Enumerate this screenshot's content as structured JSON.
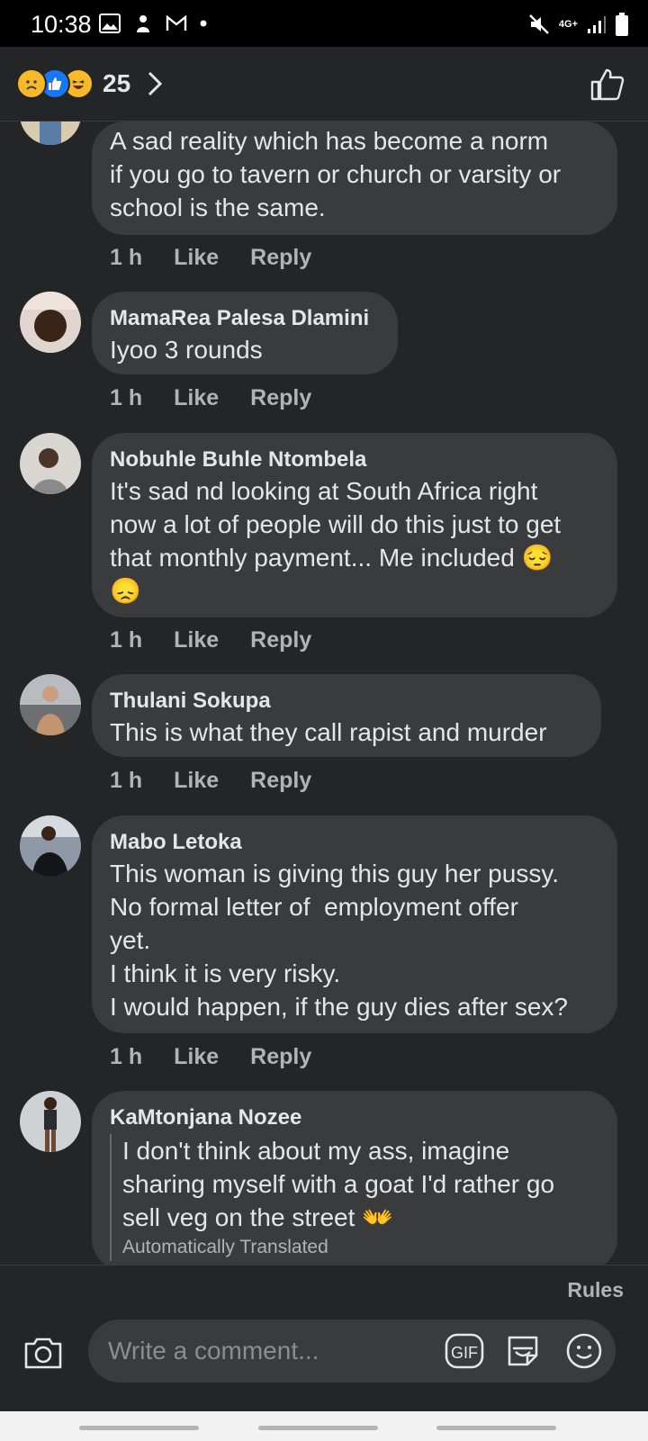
{
  "status_bar": {
    "time": "10:38",
    "network": "4G+"
  },
  "header": {
    "reaction_count": "25",
    "reactions": [
      "sad",
      "like",
      "haha"
    ]
  },
  "comments": [
    {
      "author": "",
      "text": "A sad reality which has become a norm\nif you go to tavern or church or varsity or\nschool is the same.",
      "time": "1 h",
      "like": "Like",
      "reply": "Reply"
    },
    {
      "author": "MamaRea Palesa Dlamini",
      "text": "Iyoo 3 rounds",
      "time": "1 h",
      "like": "Like",
      "reply": "Reply"
    },
    {
      "author": "Nobuhle Buhle Ntombela",
      "text": "It's sad nd looking at South Africa right\nnow a lot of people will do this just to get\nthat monthly payment... Me included 😔\n😞",
      "time": "1 h",
      "like": "Like",
      "reply": "Reply"
    },
    {
      "author": "Thulani Sokupa",
      "text": "This is what they call rapist and murder",
      "time": "1 h",
      "like": "Like",
      "reply": "Reply"
    },
    {
      "author": "Mabo Letoka",
      "text": "This woman is giving this guy her pussy.\nNo formal letter of  employment offer\nyet.\nI think it is very risky.\nI would happen, if the guy dies after sex?",
      "time": "1 h",
      "like": "Like",
      "reply": "Reply"
    },
    {
      "author": "KaMtonjana Nozee",
      "text": "I don't think about my ass, imagine\nsharing myself with a goat I'd rather go\nsell veg on the street 👐",
      "translation_note": "Automatically Translated"
    }
  ],
  "footer": {
    "rules": "Rules",
    "input_placeholder": "Write a comment...",
    "gif": "GIF"
  },
  "colors": {
    "background": "#242526",
    "bubble": "#3a3b3c",
    "secondary_text": "#b0b3b8",
    "like_blue": "#1877f2"
  }
}
